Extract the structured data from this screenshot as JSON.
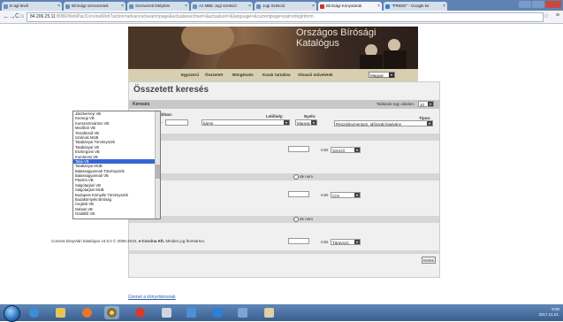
{
  "browser": {
    "tabs": [
      {
        "label": "E-ügl levél"
      },
      {
        "label": "Bírósági szervezetek"
      },
      {
        "label": "Szervezeti felépítés"
      },
      {
        "label": "Az MBE Jogi Szekció"
      },
      {
        "label": "Jogi Szekció"
      },
      {
        "label": "Bírósági Könyvtárak"
      },
      {
        "label": "\"PRIMO\" - Google ke"
      }
    ],
    "url_host": "84.206.25.11",
    "url_path": ":8080/WebPac/CorvinaWeb?action=advancedsearchpage&actualsearchset=&actualsort=&language=&currentpage=patronloginform"
  },
  "banner": {
    "title_line1": "Országos Bírósági",
    "title_line2": "Katalógus"
  },
  "mainnav": {
    "items": [
      "Egyszerű",
      "Összetett",
      "Böngészés",
      "Kosár tartalma",
      "Olvasói műveletek"
    ],
    "language": "Magyar"
  },
  "search": {
    "page_title": "Összetett keresés",
    "section_label": "Keresés",
    "results_per_page_label": "Találatok egy oldalon:",
    "results_per_page_value": "10",
    "labels": {
      "year": "Időtan:",
      "location": "Lelőhely:",
      "language": "Nyelv:",
      "type": "Típus:"
    },
    "location_value": "bármi",
    "language_value": "Magyar",
    "type_value": "Részdokumentum, időszaki kiadvány",
    "mint_label": "mint",
    "field_1": "Szerző",
    "field_2": "Cím",
    "field_3": "Tárgyszó",
    "and_not": "de nem",
    "search_button": "Keres"
  },
  "dropdown": {
    "selected_index": 10,
    "items": [
      "Jászberényi VB",
      "Kecsegi VB",
      "Kunszentmártoni VB",
      "Mezőtúri VB",
      "Tiszafüredi VB",
      "Szolnoki MUB",
      "Tatabányai Törvényszék",
      "Tatabányai VB",
      "Esztergomi VB",
      "Komáromi VB",
      "Tatai VB",
      "Tatabányai MUB",
      "Balassagyarmati Törvényszék",
      "Balassagyarmati VB",
      "Pásztói VB",
      "Salgótarjáni VB",
      "Salgótarjáni MUB",
      "Budapest Környéki Törvényszék",
      "Budakörnyéki Bíróság",
      "Ceglédi VB",
      "Dabasi VB",
      "Gödöllői VB"
    ]
  },
  "footer": {
    "text_prefix": "Corvina könyvtári katalógus v3.5.0 © 2005-2010,",
    "brand": "e-Corvina Kft.",
    "text_suffix": "Minden jog fenntartva.",
    "link": "Üzenet a könyvtárosnak"
  },
  "taskbar": {
    "time": "9:00",
    "date": "2017.11.21."
  }
}
